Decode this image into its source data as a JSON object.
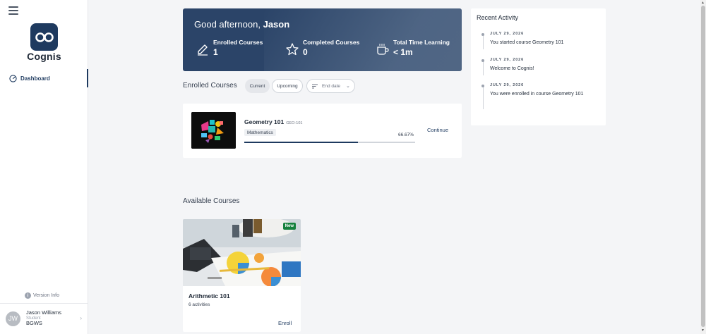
{
  "app": {
    "name": "Cognis"
  },
  "sidebar": {
    "nav": [
      {
        "label": "Dashboard",
        "icon": "dashboard-gauge-icon",
        "active": true
      }
    ],
    "version_label": "Version Info",
    "user": {
      "initials": "JW",
      "name": "Jason Williams",
      "role": "Student",
      "org": "BGWS"
    }
  },
  "hero": {
    "greeting_prefix": "Good afternoon,",
    "user_first_name": "Jason",
    "stats": [
      {
        "label": "Enrolled Courses",
        "value": "1",
        "icon": "pencil-icon"
      },
      {
        "label": "Completed Courses",
        "value": "0",
        "icon": "star-icon"
      },
      {
        "label": "Total Time Learning",
        "value": "< 1m",
        "icon": "coffee-cup-icon"
      }
    ]
  },
  "enrolled": {
    "title": "Enrolled Courses",
    "filters": {
      "current": "Current",
      "upcoming": "Upcoming",
      "sort": "End date"
    },
    "courses": [
      {
        "title": "Geometry 101",
        "code": "GEO-101",
        "tag": "Mathematics",
        "progress_pct": 66.67,
        "progress_text": "66.67%",
        "action": "Continue"
      }
    ]
  },
  "available": {
    "title": "Available Courses",
    "courses": [
      {
        "title": "Arithmetic 101",
        "subtitle": "6 activities",
        "badge": "New",
        "action": "Enroll"
      }
    ]
  },
  "activity": {
    "title": "Recent Activity",
    "items": [
      {
        "date": "JULY 29, 2026",
        "text": "You started course Geometry 101"
      },
      {
        "date": "JULY 29, 2026",
        "text": "Welcome to Cognis!"
      },
      {
        "date": "JULY 29, 2026",
        "text": "You were enrolled in course Geometry 101"
      }
    ]
  },
  "colors": {
    "brand": "#1e3a5f",
    "hero_bg": "#2b4468",
    "badge_new": "#15803d"
  }
}
